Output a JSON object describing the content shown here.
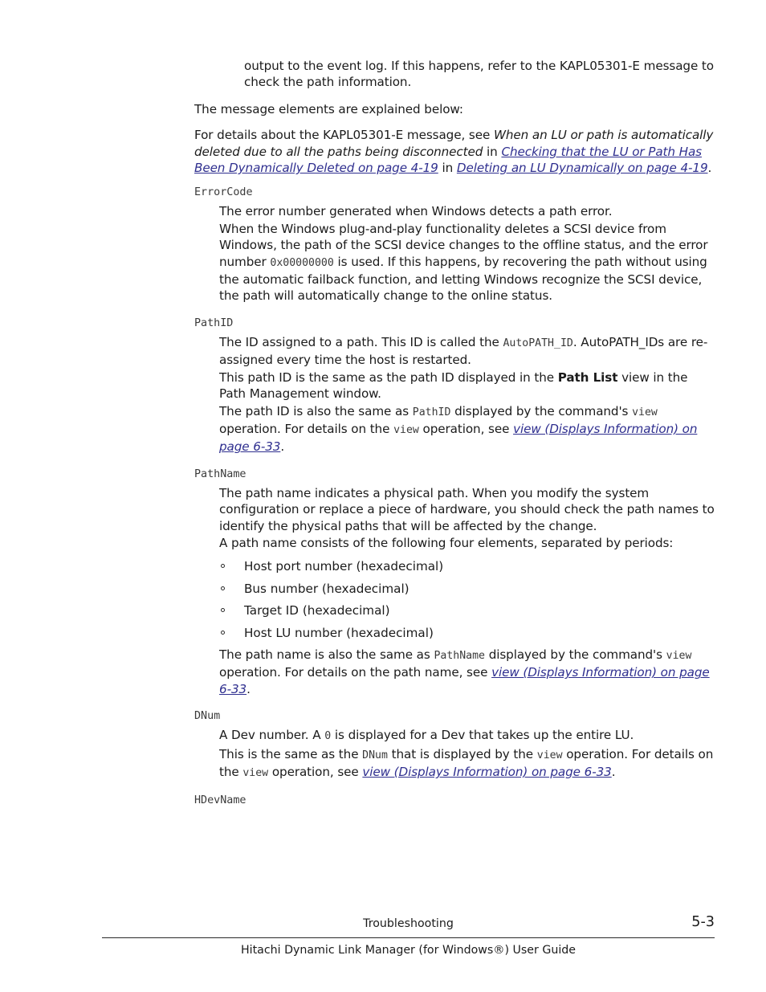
{
  "document": {
    "page_number": "5-3",
    "chapter": "Troubleshooting",
    "guide_title": "Hitachi Dynamic Link Manager (for Windows®) User Guide"
  },
  "colors": {
    "link": "#2f2f8f",
    "text": "#1b1b1b",
    "mono": "#3a3a3a"
  },
  "body": {
    "continuation_paragraph": "output to the event log. If this happens, refer to the KAPL05301-E message to check the path information.",
    "intro_paragraph": "The message elements are explained below:",
    "details_paragraph": {
      "lead": "For details about the KAPL05301-E message, see ",
      "italic_title": "When an LU or path is automatically deleted due to all the paths being disconnected",
      "mid1": " in ",
      "link1": "Checking that the LU or Path Has Been Dynamically Deleted on page 4-19",
      "mid2": " in ",
      "link2": "Deleting an LU Dynamically on page 4-19",
      "tail": "."
    }
  },
  "definitions": [
    {
      "term": "ErrorCode",
      "paragraphs": [
        {
          "text": "The error number generated when Windows detects a path error."
        },
        {
          "lead": "When the Windows plug-and-play functionality deletes a SCSI device from Windows, the path of the SCSI device changes to the offline status, and the error number ",
          "code": "0x00000000",
          "tail": " is used. If this happens, by recovering the path without using the automatic failback function, and letting Windows recognize the SCSI device, the path will automatically change to the online status."
        }
      ]
    },
    {
      "term": "PathID",
      "paragraphs": [
        {
          "lead": "The ID assigned to a path. This ID is called the ",
          "code": "AutoPATH_ID",
          "tail": ". AutoPATH_IDs are re-assigned every time the host is restarted."
        },
        {
          "lead": "This path ID is the same as the path ID displayed in the ",
          "bold": "Path List",
          "tail": " view in the Path Management window."
        },
        {
          "lead": "The path ID is also the same as ",
          "code": "PathID",
          "mid": " displayed by the command's ",
          "code2": "view",
          "mid2": " operation. For details on the ",
          "code3": "view",
          "mid3": " operation, see ",
          "link": "view (Displays Information) on page 6-33",
          "tail": "."
        }
      ]
    },
    {
      "term": "PathName",
      "paragraphs": [
        {
          "text": "The path name indicates a physical path. When you modify the system configuration or replace a piece of hardware, you should check the path names to identify the physical paths that will be affected by the change."
        },
        {
          "text": "A path name consists of the following four elements, separated by periods:"
        }
      ],
      "list": [
        "Host port number (hexadecimal)",
        "Bus number (hexadecimal)",
        "Target ID (hexadecimal)",
        "Host LU number (hexadecimal)"
      ],
      "after_list": {
        "lead": "The path name is also the same as ",
        "code": "PathName",
        "mid": " displayed by the command's ",
        "code2": "view",
        "mid2": " operation. For details on the path name, see ",
        "link": "view (Displays Information) on page 6-33",
        "tail": "."
      }
    },
    {
      "term": "DNum",
      "paragraphs": [
        {
          "lead": "A Dev number. A ",
          "code": "0",
          "tail": " is displayed for a Dev that takes up the entire LU."
        },
        {
          "lead": "This is the same as the ",
          "code": "DNum",
          "mid": " that is displayed by the ",
          "code2": "view",
          "mid2": " operation. For details on the ",
          "code3": "view",
          "mid3": " operation, see ",
          "link": "view (Displays Information) on page 6-33",
          "tail": "."
        }
      ]
    },
    {
      "term": "HDevName",
      "paragraphs": []
    }
  ]
}
